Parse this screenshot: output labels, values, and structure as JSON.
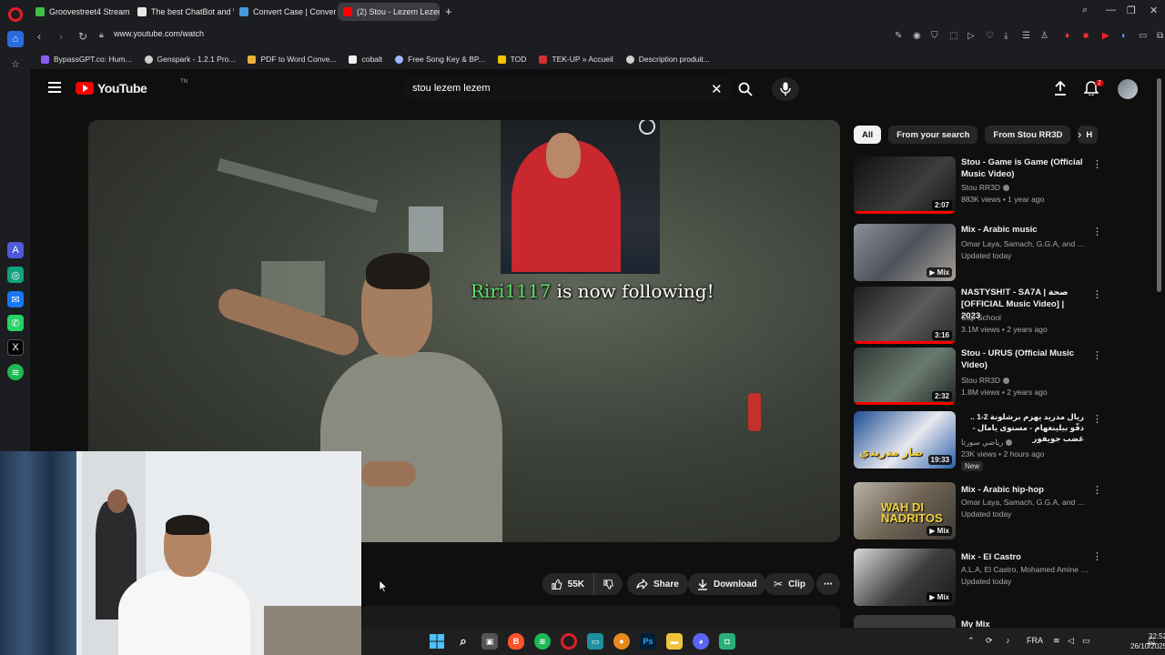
{
  "browser": {
    "tabs": [
      {
        "title": "Groovestreet4 Stream - W",
        "color": "#3fbf4a"
      },
      {
        "title": "The best ChatBot and Wi",
        "color": "#e8e8e8"
      },
      {
        "title": "Convert Case | Convert up",
        "color": "#4a9ad8"
      },
      {
        "title": "(2) Stou - Lezem Lezem",
        "color": "#ff0000"
      }
    ],
    "url": "www.youtube.com/watch",
    "bookmarks": [
      {
        "label": "BypassGPT.co: Hum...",
        "color": "#8a5cf0"
      },
      {
        "label": "Genspark - 1.2.1 Pro...",
        "color": "#cfcfcf"
      },
      {
        "label": "PDF to Word Conve...",
        "color": "#e8b13a"
      },
      {
        "label": "cobalt",
        "color": "#f0f0f0"
      },
      {
        "label": "Free Song Key & BP...",
        "color": "#9fb8ff"
      },
      {
        "label": "TOD",
        "color": "#f2c200"
      },
      {
        "label": "TEK-UP » Accueil",
        "color": "#d33030"
      },
      {
        "label": "Description produit...",
        "color": "#cfcfcf"
      }
    ]
  },
  "youtube": {
    "logo_text": "YouTube",
    "country": "TN",
    "search_query": "stou lezem lezem",
    "notifications_count": "2",
    "video_overlay": {
      "follower": "Riri1117",
      "follow_text": "is now following!"
    },
    "actions": {
      "likes": "55K",
      "share": "Share",
      "download": "Download",
      "clip": "Clip"
    },
    "chips": [
      "All",
      "From your search",
      "From Stou RR3D",
      "H"
    ],
    "recommendations": [
      {
        "title": "Stou - Game is Game (Official Music Video)",
        "channel": "Stou RR3D",
        "verified": true,
        "meta": "883K views • 1 year ago",
        "duration": "2:07",
        "progress": 1.0,
        "thumb": "#2a2a2a"
      },
      {
        "title": "Mix - Arabic music",
        "channel": "Omar Laya, Samach, G.G.A, and more",
        "meta": "Updated today",
        "mix": "Mix",
        "thumb": "#6b6e7a"
      },
      {
        "title": "NASTYSH!T - SA7A | صحة [OFFICIAL Music Video] | 2023",
        "channel": "Cap School",
        "meta": "3.1M views • 2 years ago",
        "duration": "3:16",
        "progress": 1.0,
        "thumb": "#3a3a3a"
      },
      {
        "title": "Stou - URUS (Official Music Video)",
        "channel": "Stou RR3D",
        "verified": true,
        "meta": "1.8M views • 2 years ago",
        "duration": "2:32",
        "progress": 1.0,
        "thumb": "#45504a"
      },
      {
        "title": "ريال مدريد يهزم برشلونة 2-1 .. دقّو بيلينغهام - مستوى يامال - غضب جويفور",
        "channel": "رياضي سورتا",
        "verified": true,
        "meta": "23K views • 2 hours ago",
        "duration": "19:33",
        "badge": "New",
        "thumb": "#1e4f8f",
        "thumb_text": "صار مدريدي"
      },
      {
        "title": "Mix - Arabic hip-hop",
        "channel": "Omar Laya, Samach, G.G.A, and more",
        "meta": "Updated today",
        "mix": "Mix",
        "thumb": "#7a6a52",
        "thumb_text": "WAH DI NADRITOS"
      },
      {
        "title": "Mix - El Castro",
        "channel": "A.L.A, El Castro, Mohamed Amine Hamz...",
        "meta": "Updated today",
        "mix": "Mix",
        "thumb": "#55585c"
      },
      {
        "title": "My Mix",
        "thumb": "#3a3a3a"
      }
    ]
  },
  "taskbar": {
    "language": "FRA",
    "time": "22:52",
    "date": "26/10/2025"
  }
}
